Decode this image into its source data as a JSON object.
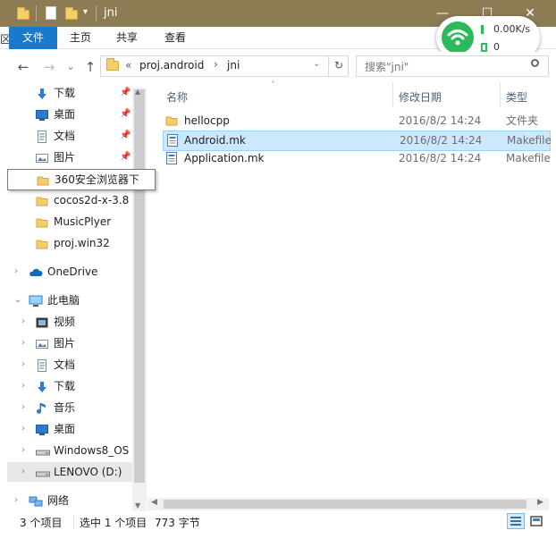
{
  "window": {
    "title": "jni",
    "buttons": {
      "minimize": "—",
      "maximize": "☐",
      "close": "✕"
    }
  },
  "ribbon": {
    "tabs": [
      "文件",
      "主页",
      "共享",
      "查看"
    ],
    "left_edge_text": "区"
  },
  "network_widget": {
    "speed_up": "0.00K/s",
    "speed_down": "0",
    "accent": "#2eb85c"
  },
  "address": {
    "back": "←",
    "forward": "→",
    "dropdown": "⌄",
    "up": "↑",
    "prefix": "«",
    "crumbs": [
      "proj.android",
      "jni"
    ],
    "separator": "›",
    "search_placeholder": "搜索\"jni\""
  },
  "nav": {
    "quick_access": [
      {
        "label": "下载",
        "icon": "download-icon",
        "pinned": true
      },
      {
        "label": "桌面",
        "icon": "desktop-icon",
        "pinned": true
      },
      {
        "label": "文档",
        "icon": "document-icon",
        "pinned": true
      },
      {
        "label": "图片",
        "icon": "pictures-icon",
        "pinned": true
      },
      {
        "label": "360安全浏览器下",
        "icon": "folder-icon",
        "pinned": false,
        "tooltip": true
      },
      {
        "label": "cocos2d-x-3.8",
        "icon": "folder-icon",
        "pinned": false
      },
      {
        "label": "MusicPlyer",
        "icon": "folder-icon",
        "pinned": false
      },
      {
        "label": "proj.win32",
        "icon": "folder-icon",
        "pinned": false
      }
    ],
    "onedrive": "OneDrive",
    "this_pc": "此电脑",
    "pc_items": [
      {
        "label": "视频",
        "icon": "video-icon"
      },
      {
        "label": "图片",
        "icon": "pictures-icon"
      },
      {
        "label": "文档",
        "icon": "document-icon"
      },
      {
        "label": "下载",
        "icon": "download-icon"
      },
      {
        "label": "音乐",
        "icon": "music-icon"
      },
      {
        "label": "桌面",
        "icon": "desktop-icon"
      },
      {
        "label": "Windows8_OS",
        "icon": "drive-icon"
      },
      {
        "label": "LENOVO (D:)",
        "icon": "drive-icon"
      }
    ],
    "network": "网络"
  },
  "columns": {
    "name": "名称",
    "date": "修改日期",
    "type": "类型"
  },
  "files": [
    {
      "name": "hellocpp",
      "date": "2016/8/2 14:24",
      "type": "文件夹",
      "icon": "folder-icon"
    },
    {
      "name": "Android.mk",
      "date": "2016/8/2 14:24",
      "type": "Makefile",
      "icon": "makefile-icon",
      "selected": true
    },
    {
      "name": "Application.mk",
      "date": "2016/8/2 14:24",
      "type": "Makefile",
      "icon": "makefile-icon"
    }
  ],
  "status": {
    "count": "3 个项目",
    "selection": "选中 1 个项目",
    "size": "773 字节"
  }
}
